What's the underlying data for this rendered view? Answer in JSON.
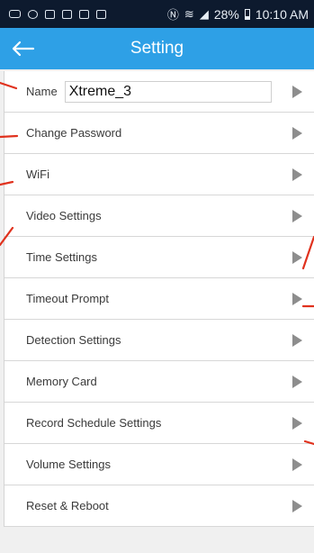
{
  "status_bar": {
    "battery": "28%",
    "time": "10:10 AM",
    "icons": [
      "message-icon",
      "wifi-notification-icon",
      "photo-icon",
      "photo-icon",
      "photo-icon",
      "photo-icon",
      "nfc-icon",
      "wifi-signal-icon",
      "cell-signal-icon",
      "battery-icon"
    ]
  },
  "app_bar": {
    "title": "Setting",
    "back_icon": "back-arrow-icon",
    "color": "#2ea0e6"
  },
  "settings": {
    "name_label": "Name",
    "name_value": "Xtreme_3",
    "items": [
      {
        "label": "Change Password"
      },
      {
        "label": "WiFi"
      },
      {
        "label": "Video Settings"
      },
      {
        "label": "Time Settings"
      },
      {
        "label": "Timeout Prompt"
      },
      {
        "label": "Detection Settings"
      },
      {
        "label": "Memory Card"
      },
      {
        "label": "Record Schedule Settings"
      },
      {
        "label": "Volume Settings"
      },
      {
        "label": "Reset & Reboot"
      }
    ],
    "chevron_icon": "chevron-right-icon"
  },
  "annotation_color": "#e0321e"
}
